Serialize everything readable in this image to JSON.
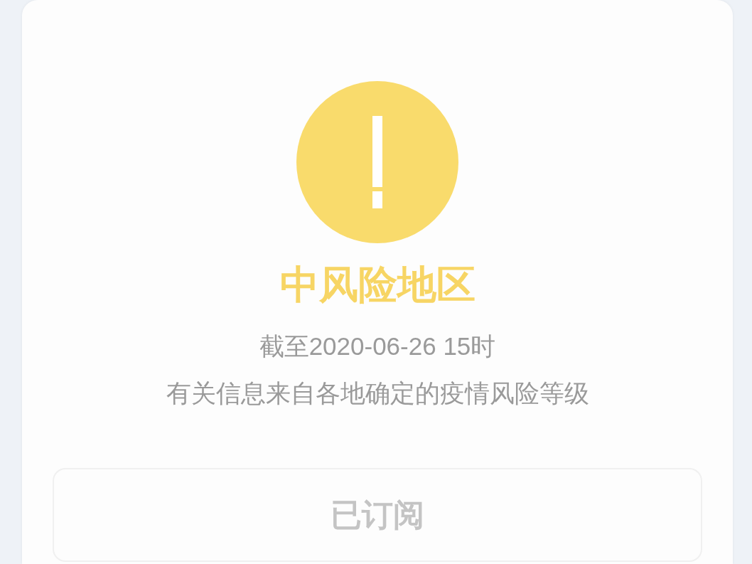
{
  "status": {
    "title": "中风险地区",
    "updated": "截至2020-06-26 15时",
    "note": "有关信息来自各地确定的疫情风险等级"
  },
  "subscribe_button": {
    "label": "已订阅",
    "disabled": true
  }
}
